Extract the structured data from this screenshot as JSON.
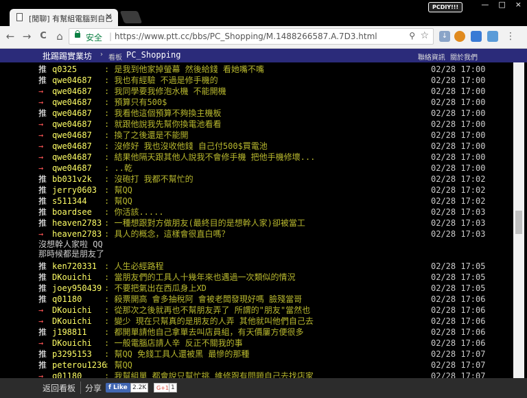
{
  "browser": {
    "tab_title": "[閒聊] 有幫組電腦到自已",
    "tab_close": "×",
    "brand_badge": "PCDIY!!!",
    "window_controls": [
      "—",
      "□",
      "×"
    ],
    "nav": {
      "back": "←",
      "forward": "→",
      "reload": "C",
      "home": "⌂"
    },
    "secure_label": "安全",
    "url": "https://www.ptt.cc/bbs/PC_Shopping/M.1488266587.A.7D3.html",
    "zoom_icon": "⚲",
    "star_icon": "☆"
  },
  "ptt": {
    "logo": "批踢踢實業坊",
    "breadcrumb_sep": "›",
    "breadcrumb_label": "看板",
    "board": "PC_Shopping",
    "links": [
      "聯絡資訊",
      "關於我們"
    ]
  },
  "comments": [
    {
      "tag": "推",
      "type": "push",
      "user": "q0325",
      "text": ": 是我到他家掉螢幕  然後給錢  看她嘴不嘴",
      "time": "02/28 17:00"
    },
    {
      "tag": "推",
      "type": "push",
      "user": "qwe04687",
      "text": ": 我也有經驗 不過是修手機的",
      "time": "02/28 17:00"
    },
    {
      "tag": "→",
      "type": "arrow",
      "user": "qwe04687",
      "text": ": 我同學要我修泡水機 不能開機",
      "time": "02/28 17:00"
    },
    {
      "tag": "→",
      "type": "arrow",
      "user": "qwe04687",
      "text": ": 預算只有500$",
      "time": "02/28 17:00"
    },
    {
      "tag": "推",
      "type": "push",
      "user": "qwe04687",
      "text": ": 我看他這個預算不夠換主機板",
      "time": "02/28 17:00"
    },
    {
      "tag": "→",
      "type": "arrow",
      "user": "qwe04687",
      "text": ": 就跟他說我先幫你換電池看看",
      "time": "02/28 17:00"
    },
    {
      "tag": "→",
      "type": "arrow",
      "user": "qwe04687",
      "text": ": 換了之後還是不能開",
      "time": "02/28 17:00"
    },
    {
      "tag": "→",
      "type": "arrow",
      "user": "qwe04687",
      "text": ": 沒修好 我也沒收他錢 自己付500$買電池",
      "time": "02/28 17:00"
    },
    {
      "tag": "→",
      "type": "arrow",
      "user": "qwe04687",
      "text": ": 結果他隔天跟其他人說我不會修手機 把他手機修壞...",
      "time": "02/28 17:00"
    },
    {
      "tag": "→",
      "type": "arrow",
      "user": "qwe04687",
      "text": ": ..乾",
      "time": "02/28 17:00"
    },
    {
      "tag": "推",
      "type": "push",
      "user": "bb031v2k",
      "text": ": 沒砲打 我都不幫忙的",
      "time": "02/28 17:02"
    },
    {
      "tag": "推",
      "type": "push",
      "user": "jerry0603",
      "text": ": 幫QQ",
      "time": "02/28 17:02"
    },
    {
      "tag": "推",
      "type": "push",
      "user": "s511344",
      "text": ": 幫QQ",
      "time": "02/28 17:02"
    },
    {
      "tag": "推",
      "type": "push",
      "user": "boardsee",
      "text": ": 你活該.....",
      "time": "02/28 17:03"
    },
    {
      "tag": "推",
      "type": "push",
      "user": "heaven2783",
      "text": ": 一種想跟對方做朋友(最終目的是想幹人家)卻被當工",
      "time": "02/28 17:03"
    },
    {
      "tag": "→",
      "type": "arrow",
      "user": "heaven2783",
      "text": ": 具人的概念，這樣會很直白嗎？",
      "time": "02/28 17:03"
    }
  ],
  "plain_lines": [
    "沒想幹人家啦 QQ",
    "那時候都是朋友了"
  ],
  "comments2": [
    {
      "tag": "推",
      "type": "push",
      "user": "ken720331",
      "text": ": 人生必經路程",
      "time": "02/28 17:05"
    },
    {
      "tag": "推",
      "type": "push",
      "user": "DKouichi",
      "text": ": 當朋友們的工具人十幾年來也遇過一次類似的情況",
      "time": "02/28 17:05"
    },
    {
      "tag": "推",
      "type": "push",
      "user": "joey950439",
      "text": ": 不要把氣出在西瓜身上XD",
      "time": "02/28 17:05"
    },
    {
      "tag": "推",
      "type": "push",
      "user": "q01180",
      "text": ": 殺票開高 會多抽稅阿 會被老闆發現好嗎 臉殘當哥",
      "time": "02/28 17:06"
    },
    {
      "tag": "→",
      "type": "arrow",
      "user": "DKouichi",
      "text": ": 從那次之後就再也不幫朋友弄了 所謂的\"朋友\"當然也",
      "time": "02/28 17:06"
    },
    {
      "tag": "→",
      "type": "arrow",
      "user": "DKouichi",
      "text": ": 變少 現在只幫真的是朋友的人弄 其他就叫他們自己去",
      "time": "02/28 17:06"
    },
    {
      "tag": "推",
      "type": "push",
      "user": "j198811",
      "text": ": 都開單請他自己拿單去叫店員組，有天價屢方便很多",
      "time": "02/28 17:06"
    },
    {
      "tag": "→",
      "type": "arrow",
      "user": "DKouichi",
      "text": ": 一般電腦店請人辛 反正不關我的事",
      "time": "02/28 17:06"
    },
    {
      "tag": "推",
      "type": "push",
      "user": "p3295153",
      "text": ": 幫QQ 免錢工具人還被黑 最慘的那種",
      "time": "02/28 17:07"
    },
    {
      "tag": "推",
      "type": "push",
      "user": "peterou1236",
      "text": ": 幫QQ",
      "time": "02/28 17:07"
    },
    {
      "tag": "→",
      "type": "arrow",
      "user": "q01180",
      "text": ": 我幫組單 都會說只幫忙挑 維修跟有問題自己去找店家",
      "time": "02/28 17:07"
    }
  ],
  "footer": {
    "back_label": "返回看板",
    "share_label": "分享",
    "fb_like": "f Like",
    "fb_count": "2.2K",
    "gplus": "G+1",
    "gplus_count": "1"
  }
}
